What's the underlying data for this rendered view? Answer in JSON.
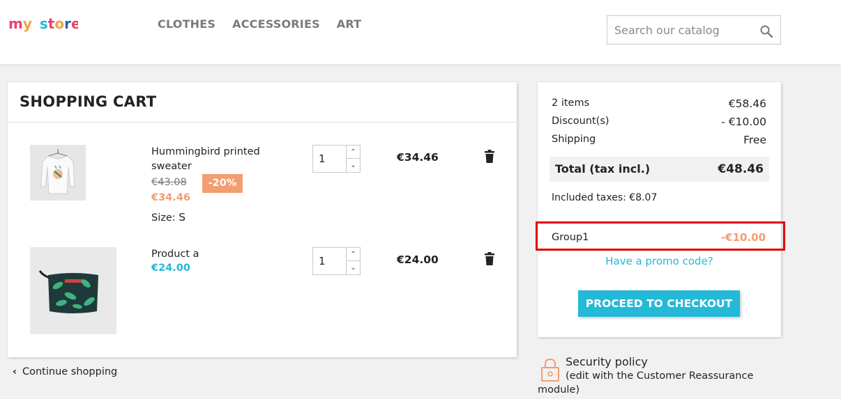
{
  "header": {
    "logo": {
      "part1": "my",
      "part2": "store"
    },
    "nav": [
      "CLOTHES",
      "ACCESSORIES",
      "ART"
    ],
    "search_placeholder": "Search our catalog"
  },
  "cart": {
    "title": "SHOPPING CART",
    "items": [
      {
        "name": "Hummingbird printed sweater",
        "old_price": "€43.08",
        "discount": "-20%",
        "price": "€34.46",
        "size_label": "Size:",
        "size_value": "S",
        "quantity": "1",
        "total": "€34.46"
      },
      {
        "name": "Product a",
        "price": "€24.00",
        "quantity": "1",
        "total": "€24.00"
      }
    ],
    "continue_label": "Continue shopping"
  },
  "summary": {
    "items_label": "2 items",
    "items_value": "€58.46",
    "discount_label": "Discount(s)",
    "discount_value": "- €10.00",
    "shipping_label": "Shipping",
    "shipping_value": "Free",
    "total_label": "Total (tax incl.)",
    "total_value": "€48.46",
    "taxes": "Included taxes: €8.07",
    "voucher_name": "Group1",
    "voucher_value": "-€10.00",
    "promo_link": "Have a promo code?",
    "checkout_label": "PROCEED TO CHECKOUT"
  },
  "reassurance": {
    "title": "Security policy",
    "description": "(edit with the Customer Reassurance module)"
  },
  "colors": {
    "accent": "#24b9d7",
    "discount": "#f39d72",
    "highlight_border": "#e00000"
  }
}
